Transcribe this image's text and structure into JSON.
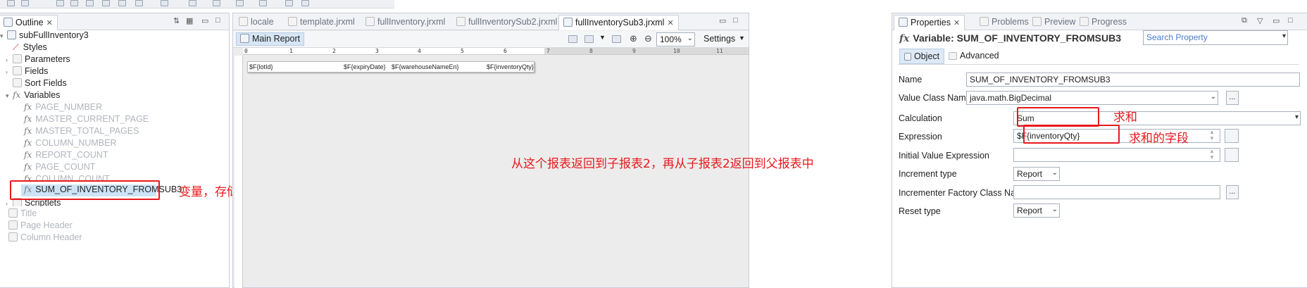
{
  "outline": {
    "tab_label": "Outline",
    "root": "subFullInventory3",
    "items": {
      "styles": "Styles",
      "parameters": "Parameters",
      "fields": "Fields",
      "sort_fields": "Sort Fields",
      "variables": "Variables",
      "scriptlets": "Scriptlets",
      "title": "Title",
      "page_header": "Page Header",
      "column_header": "Column Header"
    },
    "variables": [
      "PAGE_NUMBER",
      "MASTER_CURRENT_PAGE",
      "MASTER_TOTAL_PAGES",
      "COLUMN_NUMBER",
      "REPORT_COUNT",
      "PAGE_COUNT",
      "COLUMN_COUNT",
      "SUM_OF_INVENTORY_FROMSUB3"
    ]
  },
  "editor": {
    "tabs": [
      "locale",
      "template.jrxml",
      "fullInventory.jrxml",
      "fullInventorySub2.jrxml",
      "fullInventorySub3.jrxml"
    ],
    "main_report_label": "Main Report",
    "zoom": "100%",
    "settings_label": "Settings",
    "ruler_numbers": [
      "0",
      "1",
      "2",
      "3",
      "4",
      "5",
      "6",
      "7",
      "8",
      "9",
      "10",
      "11"
    ],
    "band_fields": [
      "$F{lotId}",
      "$F{expiryDate}",
      "$F{warehouseNameEn}",
      "$F{inventoryQty}"
    ]
  },
  "properties": {
    "tabs": [
      "Properties",
      "Problems",
      "Preview",
      "Progress"
    ],
    "title": "Variable: SUM_OF_INVENTORY_FROMSUB3",
    "search_placeholder": "Search Property",
    "subtabs": [
      "Object",
      "Advanced"
    ],
    "labels": {
      "name": "Name",
      "value_class": "Value Class Name",
      "calculation": "Calculation",
      "expression": "Expression",
      "initial_value": "Initial Value Expression",
      "increment_type": "Increment type",
      "incrementer_factory": "Incrementer Factory Class Name",
      "reset_type": "Reset type"
    },
    "values": {
      "name": "SUM_OF_INVENTORY_FROMSUB3",
      "value_class": "java.math.BigDecimal",
      "calculation": "Sum",
      "expression": "$F{inventoryQty}",
      "initial_value": "",
      "increment_type": "Report",
      "incrementer_factory": "",
      "reset_type": "Report"
    }
  },
  "annotations": {
    "variable_note": "变量，存储计算结果的",
    "return_note": "从这个报表返回到子报表2，再从子报表2返回到父报表中",
    "sum_note": "求和",
    "field_note": "求和的字段"
  },
  "colors": {
    "annotation_red": "#e8191c",
    "selection": "#cde4f7"
  }
}
